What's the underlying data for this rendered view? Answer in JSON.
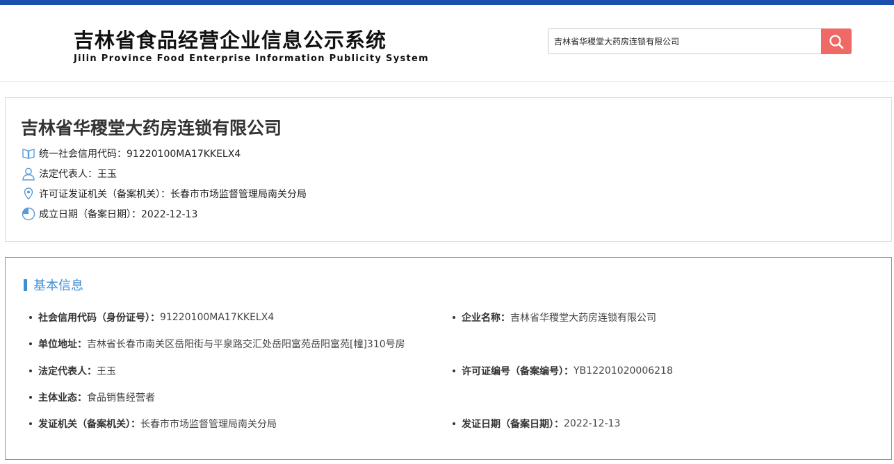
{
  "header": {
    "title_cn": "吉林省食品经营企业信息公示系统",
    "title_en": "Jilin Province Food Enterprise Information Publicity System",
    "search_value": "吉林省华稷堂大药房连锁有限公司",
    "search_icon": "search-icon"
  },
  "company": {
    "name": "吉林省华稷堂大药房连锁有限公司",
    "credit_code": "统一社会信用代码：91220100MA17KKELX4",
    "legal_rep": "法定代表人：王玉",
    "authority": "许可证发证机关（备案机关）：长春市市场监督管理局南关分局",
    "date": "成立日期（备案日期）：2022-12-13"
  },
  "basic_info": {
    "title": "基本信息",
    "fields": [
      {
        "label": "社会信用代码（身份证号）：",
        "value": "91220100MA17KKELX4"
      },
      {
        "label": "企业名称：",
        "value": "吉林省华稷堂大药房连锁有限公司"
      },
      {
        "label": "单位地址：",
        "value": "吉林省长春市南关区岳阳街与平泉路交汇处岳阳富苑岳阳富苑[幢]310号房"
      },
      {
        "label": "法定代表人：",
        "value": "王玉"
      },
      {
        "label": "许可证编号（备案编号）：",
        "value": "YB12201020006218"
      },
      {
        "label": "主体业态：",
        "value": "食品销售经营者"
      },
      {
        "label": "发证机关（备案机关）：",
        "value": "长春市市场监督管理局南关分局"
      },
      {
        "label": "发证日期（备案日期）：",
        "value": "2022-12-13"
      }
    ]
  },
  "colors": {
    "top_bar": "#1a4fb0",
    "search_button": "#ef6a66",
    "accent": "#3d8fd4",
    "icon": "#5a9bd5"
  }
}
